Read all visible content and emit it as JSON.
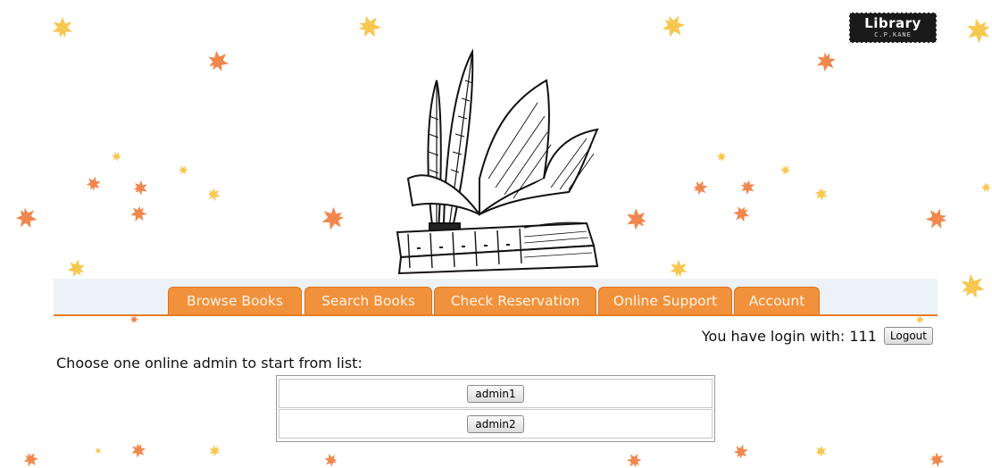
{
  "logo": {
    "line1": "Library",
    "line2": "C.P.KANE"
  },
  "nav": {
    "tabs": [
      {
        "label": "Browse Books"
      },
      {
        "label": "Search Books"
      },
      {
        "label": "Check Reservation"
      },
      {
        "label": "Online Support"
      },
      {
        "label": "Account"
      }
    ]
  },
  "session": {
    "login_text": "You have login with: 111",
    "logout_label": "Logout"
  },
  "chat": {
    "instruction": "Choose one online admin to start from list:",
    "admins": [
      {
        "label": "admin1"
      },
      {
        "label": "admin2"
      }
    ]
  },
  "colors": {
    "tab_orange": "#f1913b",
    "nav_underline": "#e87c1f",
    "leaf_orange": "#f07a3a",
    "leaf_yellow": "#f6c23d"
  },
  "icons": [
    "maple-leaf-icon",
    "book-quill-illustration"
  ]
}
